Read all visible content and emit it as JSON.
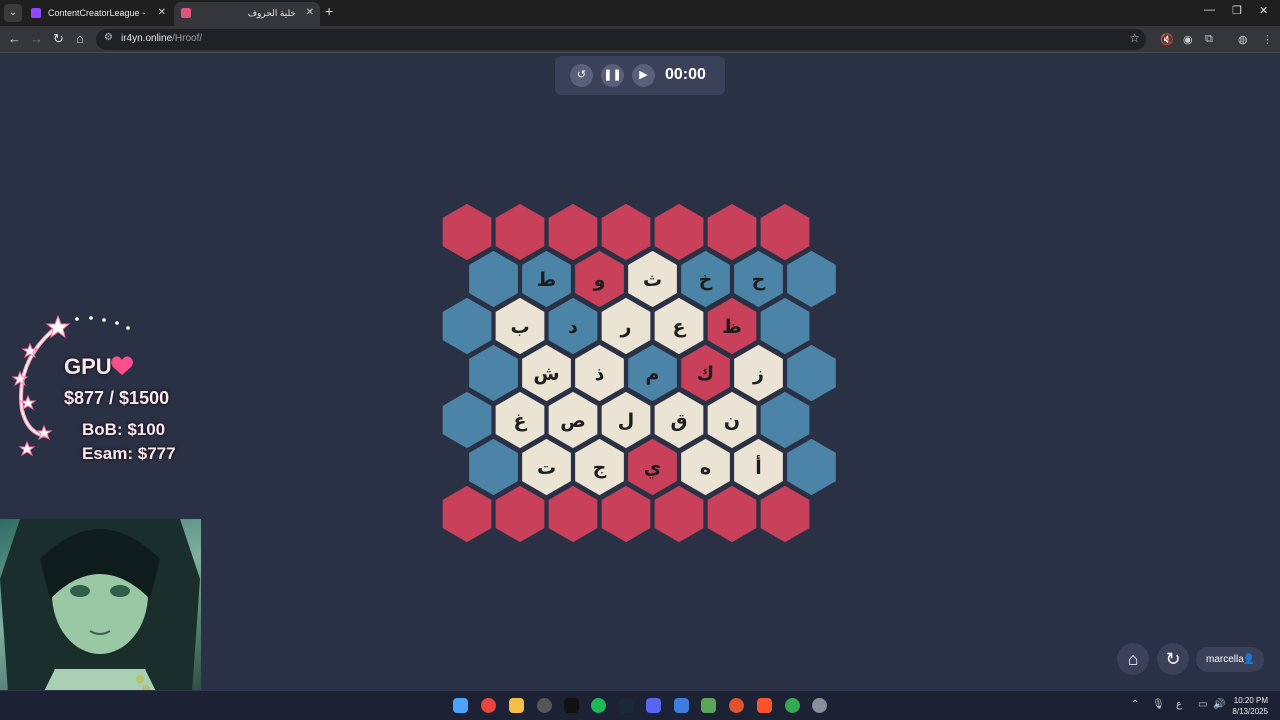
{
  "browser": {
    "tabs": [
      {
        "title": "ContentCreatorLeague - Twitch",
        "active": false,
        "favicon_color": "#9146ff"
      },
      {
        "title": "خلية الحروف",
        "active": true,
        "favicon_color": "#e0567a"
      }
    ],
    "url_host": "ir4yn.online",
    "url_path": "/Hroof/"
  },
  "timer": {
    "value": "00:00"
  },
  "colors": {
    "red": "#c9405a",
    "blue": "#4c84a8",
    "cream": "#ebe3d3",
    "background": "#2b3145"
  },
  "board": {
    "rows": [
      {
        "cells": [
          {
            "letter": "",
            "color": "red"
          },
          {
            "letter": "",
            "color": "red"
          },
          {
            "letter": "",
            "color": "red"
          },
          {
            "letter": "",
            "color": "red"
          },
          {
            "letter": "",
            "color": "red"
          },
          {
            "letter": "",
            "color": "red"
          },
          {
            "letter": "",
            "color": "red"
          }
        ]
      },
      {
        "cells": [
          {
            "letter": "",
            "color": "blue"
          },
          {
            "letter": "ط",
            "color": "blue"
          },
          {
            "letter": "و",
            "color": "red"
          },
          {
            "letter": "ث",
            "color": "cream"
          },
          {
            "letter": "خ",
            "color": "blue"
          },
          {
            "letter": "ح",
            "color": "blue"
          },
          {
            "letter": "",
            "color": "blue"
          }
        ]
      },
      {
        "cells": [
          {
            "letter": "",
            "color": "blue"
          },
          {
            "letter": "ب",
            "color": "cream"
          },
          {
            "letter": "د",
            "color": "blue"
          },
          {
            "letter": "ر",
            "color": "cream"
          },
          {
            "letter": "ع",
            "color": "cream"
          },
          {
            "letter": "ظ",
            "color": "red"
          },
          {
            "letter": "",
            "color": "blue"
          }
        ]
      },
      {
        "cells": [
          {
            "letter": "",
            "color": "blue"
          },
          {
            "letter": "ش",
            "color": "cream"
          },
          {
            "letter": "ذ",
            "color": "cream"
          },
          {
            "letter": "م",
            "color": "blue"
          },
          {
            "letter": "ك",
            "color": "red"
          },
          {
            "letter": "ز",
            "color": "cream"
          },
          {
            "letter": "",
            "color": "blue"
          }
        ]
      },
      {
        "cells": [
          {
            "letter": "",
            "color": "blue"
          },
          {
            "letter": "غ",
            "color": "cream"
          },
          {
            "letter": "ص",
            "color": "cream"
          },
          {
            "letter": "ل",
            "color": "cream"
          },
          {
            "letter": "ق",
            "color": "cream"
          },
          {
            "letter": "ن",
            "color": "cream"
          },
          {
            "letter": "",
            "color": "blue"
          }
        ]
      },
      {
        "cells": [
          {
            "letter": "",
            "color": "blue"
          },
          {
            "letter": "ت",
            "color": "cream"
          },
          {
            "letter": "ج",
            "color": "cream"
          },
          {
            "letter": "ي",
            "color": "red"
          },
          {
            "letter": "ه",
            "color": "cream"
          },
          {
            "letter": "أ",
            "color": "cream"
          },
          {
            "letter": "",
            "color": "blue"
          }
        ]
      },
      {
        "cells": [
          {
            "letter": "",
            "color": "red"
          },
          {
            "letter": "",
            "color": "red"
          },
          {
            "letter": "",
            "color": "red"
          },
          {
            "letter": "",
            "color": "red"
          },
          {
            "letter": "",
            "color": "red"
          },
          {
            "letter": "",
            "color": "red"
          },
          {
            "letter": "",
            "color": "red"
          }
        ]
      }
    ]
  },
  "overlay": {
    "gpu_title": "GPU",
    "gpu_amount": "$877 / $1500",
    "bob": "BoB: $100",
    "esam": "Esam: $777"
  },
  "user": {
    "name": "marcella"
  },
  "taskbar": {
    "time": "10:20 PM",
    "date": "8/13/2025",
    "lang": "ع"
  }
}
